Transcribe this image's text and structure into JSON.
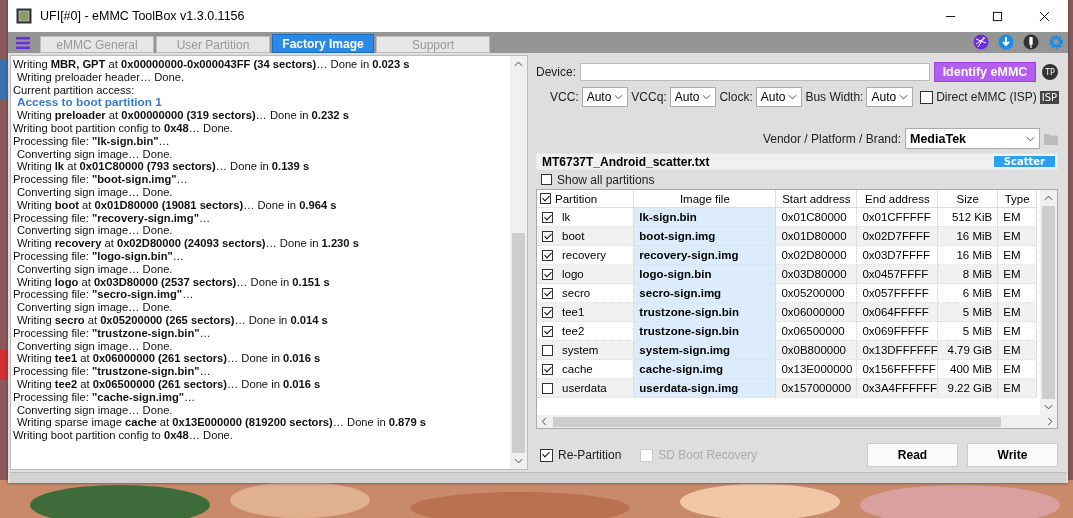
{
  "window": {
    "title": "UFI[#0] - eMMC ToolBox v1.3.0.1156"
  },
  "tabs": [
    {
      "label": "eMMC General",
      "selected": false
    },
    {
      "label": "User Partition",
      "selected": false
    },
    {
      "label": "Factory Image",
      "selected": true
    },
    {
      "label": "Support",
      "selected": false
    }
  ],
  "log": [
    {
      "kind": "main",
      "text": "Writing **MBR, GPT** at **0x00000000-0x000043FF (34 sectors)**… Done in **0.023 s**"
    },
    {
      "kind": "sub",
      "text": "Writing preloader header… Done."
    },
    {
      "kind": "main",
      "text": "Current partition access:"
    },
    {
      "kind": "highlight",
      "text": "Access to boot partition 1"
    },
    {
      "kind": "sub",
      "text": "Writing **preloader** at **0x00000000 (319 sectors)**… Done in **0.232 s**"
    },
    {
      "kind": "main",
      "text": "Writing boot partition config to **0x48**… Done."
    },
    {
      "kind": "main",
      "text": "Processing file: **\"lk-sign.bin\"**…"
    },
    {
      "kind": "sub",
      "text": "Converting sign image… Done."
    },
    {
      "kind": "sub",
      "text": "Writing **lk** at **0x01C80000 (793 sectors)**… Done in **0.139 s**"
    },
    {
      "kind": "main",
      "text": "Processing file: **\"boot-sign.img\"**…"
    },
    {
      "kind": "sub",
      "text": "Converting sign image… Done."
    },
    {
      "kind": "sub",
      "text": "Writing **boot** at **0x01D80000 (19081 sectors)**… Done in **0.964 s**"
    },
    {
      "kind": "main",
      "text": "Processing file: **\"recovery-sign.img\"**…"
    },
    {
      "kind": "sub",
      "text": "Converting sign image… Done."
    },
    {
      "kind": "sub",
      "text": "Writing **recovery** at **0x02D80000 (24093 sectors)**… Done in **1.230 s**"
    },
    {
      "kind": "main",
      "text": "Processing file: **\"logo-sign.bin\"**…"
    },
    {
      "kind": "sub",
      "text": "Converting sign image… Done."
    },
    {
      "kind": "sub",
      "text": "Writing **logo** at **0x03D80000 (2537 sectors)**… Done in **0.151 s**"
    },
    {
      "kind": "main",
      "text": "Processing file: **\"secro-sign.img\"**…"
    },
    {
      "kind": "sub",
      "text": "Converting sign image… Done."
    },
    {
      "kind": "sub",
      "text": "Writing **secro** at **0x05200000 (265 sectors)**… Done in **0.014 s**"
    },
    {
      "kind": "main",
      "text": "Processing file: **\"trustzone-sign.bin\"**…"
    },
    {
      "kind": "sub",
      "text": "Converting sign image… Done."
    },
    {
      "kind": "sub",
      "text": "Writing **tee1** at **0x06000000 (261 sectors)**… Done in **0.016 s**"
    },
    {
      "kind": "main",
      "text": "Processing file: **\"trustzone-sign.bin\"**…"
    },
    {
      "kind": "sub",
      "text": "Writing **tee2** at **0x06500000 (261 sectors)**… Done in **0.016 s**"
    },
    {
      "kind": "main",
      "text": "Processing file: **\"cache-sign.img\"**…"
    },
    {
      "kind": "sub",
      "text": "Converting sign image… Done."
    },
    {
      "kind": "sub",
      "text": "Writing sparse image **cache** at **0x13E000000 (819200 sectors)**… Done in **0.879 s**"
    },
    {
      "kind": "main",
      "text": "Writing boot partition config to **0x48**… Done."
    }
  ],
  "device": {
    "label": "Device:",
    "identify_button": "Identify eMMC",
    "tp_badge": "TP"
  },
  "selects": [
    {
      "label": "VCC:",
      "value": "Auto"
    },
    {
      "label": "VCCq:",
      "value": "Auto"
    },
    {
      "label": "Clock:",
      "value": "Auto"
    },
    {
      "label": "Bus Width:",
      "value": "Auto"
    }
  ],
  "direct_emmc": {
    "label": "Direct eMMC (ISP)",
    "checked": false,
    "badge": "ISP"
  },
  "vendor": {
    "label": "Vendor / Platform / Brand:",
    "value": "MediaTek"
  },
  "scatter": {
    "file": "MT6737T_Android_scatter.txt",
    "badge": "Scatter"
  },
  "show_all_partitions": {
    "label": "Show all partitions",
    "checked": false
  },
  "table": {
    "all_checked": true,
    "columns": [
      "Partition",
      "Image file",
      "Start address",
      "End address",
      "Size",
      "Type"
    ],
    "rows": [
      {
        "checked": true,
        "partition": "lk",
        "image": "lk-sign.bin",
        "start": "0x01C80000",
        "end": "0x01CFFFFF",
        "size": "512 KiB",
        "type": "EM"
      },
      {
        "checked": true,
        "partition": "boot",
        "image": "boot-sign.img",
        "start": "0x01D80000",
        "end": "0x02D7FFFF",
        "size": "16 MiB",
        "type": "EM"
      },
      {
        "checked": true,
        "partition": "recovery",
        "image": "recovery-sign.img",
        "start": "0x02D80000",
        "end": "0x03D7FFFF",
        "size": "16 MiB",
        "type": "EM"
      },
      {
        "checked": true,
        "partition": "logo",
        "image": "logo-sign.bin",
        "start": "0x03D80000",
        "end": "0x0457FFFF",
        "size": "8 MiB",
        "type": "EM"
      },
      {
        "checked": true,
        "partition": "secro",
        "image": "secro-sign.img",
        "start": "0x05200000",
        "end": "0x057FFFFF",
        "size": "6 MiB",
        "type": "EM"
      },
      {
        "checked": true,
        "partition": "tee1",
        "image": "trustzone-sign.bin",
        "start": "0x06000000",
        "end": "0x064FFFFF",
        "size": "5 MiB",
        "type": "EM"
      },
      {
        "checked": true,
        "partition": "tee2",
        "image": "trustzone-sign.bin",
        "start": "0x06500000",
        "end": "0x069FFFFF",
        "size": "5 MiB",
        "type": "EM"
      },
      {
        "checked": false,
        "partition": "system",
        "image": "system-sign.img",
        "start": "0x0B800000",
        "end": "0x13DFFFFFF",
        "size": "4.79 GiB",
        "type": "EM"
      },
      {
        "checked": true,
        "partition": "cache",
        "image": "cache-sign.img",
        "start": "0x13E000000",
        "end": "0x156FFFFFF",
        "size": "400 MiB",
        "type": "EM"
      },
      {
        "checked": false,
        "partition": "userdata",
        "image": "userdata-sign.img",
        "start": "0x157000000",
        "end": "0x3A4FFFFFF",
        "size": "9.22 GiB",
        "type": "EM"
      }
    ]
  },
  "options": [
    {
      "label": "Re-Partition",
      "checked": true,
      "disabled": false
    },
    {
      "label": "SD Boot Recovery",
      "checked": false,
      "disabled": true
    }
  ],
  "buttons": [
    "Read",
    "Write"
  ]
}
